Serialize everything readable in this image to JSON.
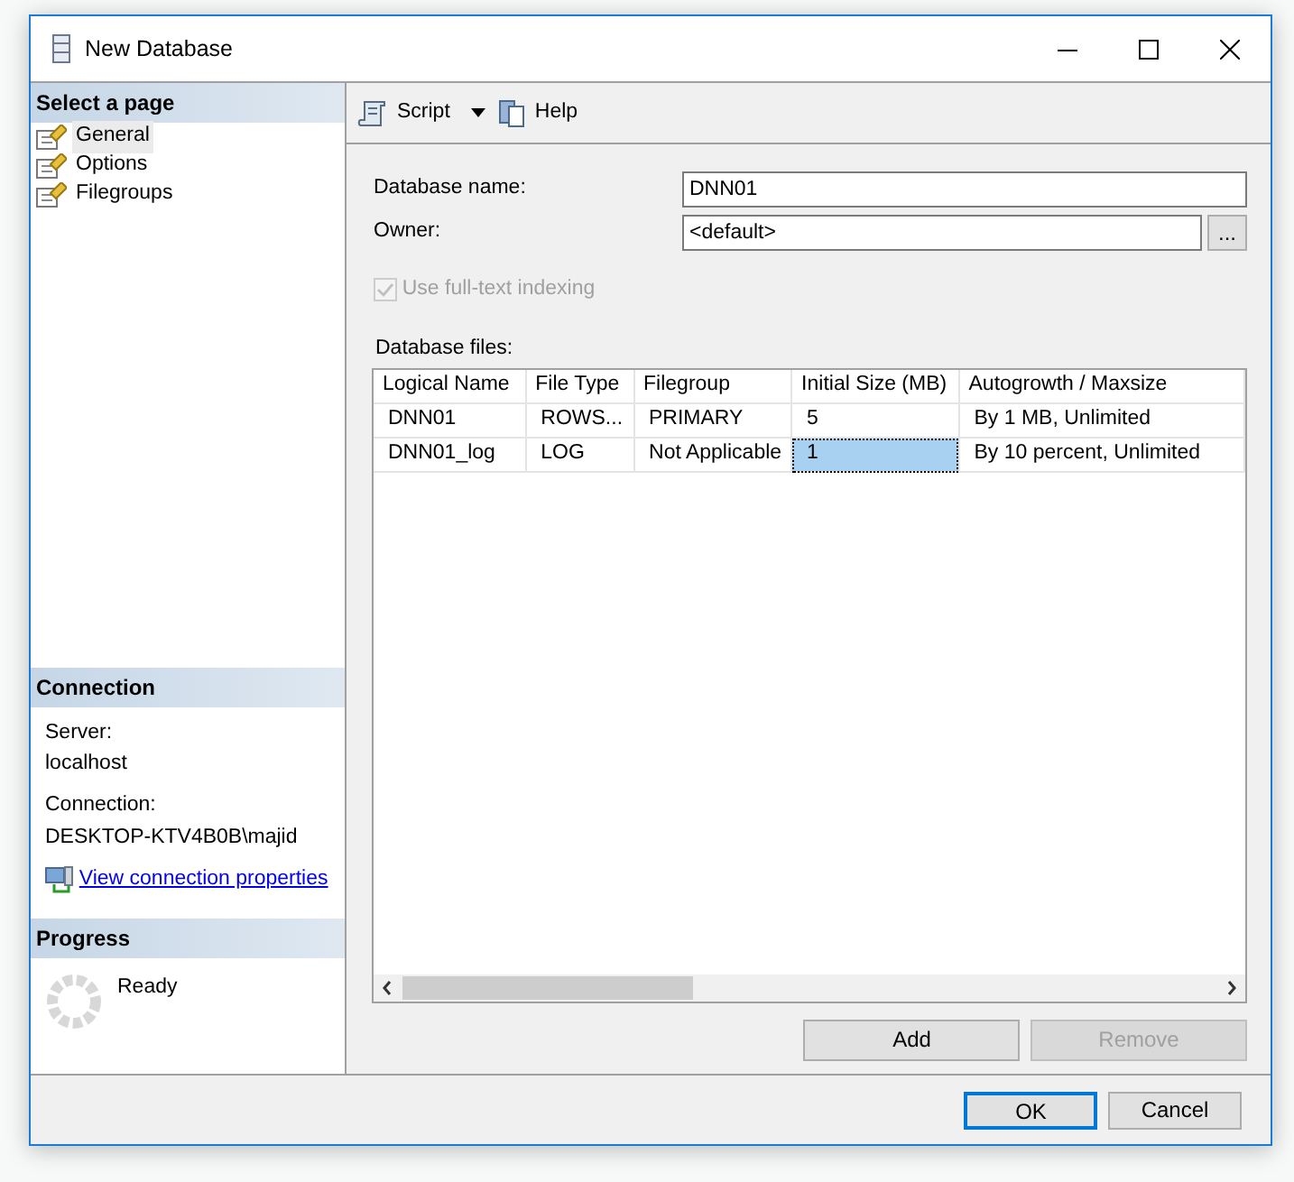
{
  "window": {
    "title": "New Database"
  },
  "sidebar": {
    "heading": "Select a page",
    "pages": [
      {
        "label": "General",
        "selected": true
      },
      {
        "label": "Options",
        "selected": false
      },
      {
        "label": "Filegroups",
        "selected": false
      }
    ]
  },
  "connection": {
    "heading": "Connection",
    "server_label": "Server:",
    "server": "localhost",
    "connection_label": "Connection:",
    "connection": "DESKTOP-KTV4B0B\\majid",
    "link": "View connection properties"
  },
  "progress": {
    "heading": "Progress",
    "status": "Ready"
  },
  "toolbar": {
    "script": "Script",
    "help": "Help"
  },
  "form": {
    "name_label": "Database name:",
    "name_value": "DNN01",
    "owner_label": "Owner:",
    "owner_value": "<default>",
    "browse": "...",
    "fulltext": {
      "label": "Use full-text indexing",
      "checked": true,
      "disabled": true
    }
  },
  "files": {
    "label": "Database files:",
    "columns": [
      "Logical Name",
      "File Type",
      "Filegroup",
      "Initial Size (MB)",
      "Autogrowth / Maxsize"
    ],
    "rows": [
      {
        "cells": [
          {
            "text": "DNN01",
            "selected": false
          },
          {
            "text": "ROWS...",
            "selected": false
          },
          {
            "text": "PRIMARY",
            "selected": false
          },
          {
            "text": "5",
            "selected": false
          },
          {
            "text": "By 1 MB, Unlimited",
            "selected": false
          }
        ]
      },
      {
        "cells": [
          {
            "text": "DNN01_log",
            "selected": false
          },
          {
            "text": "LOG",
            "selected": false
          },
          {
            "text": "Not Applicable",
            "selected": false
          },
          {
            "text": "1",
            "selected": true
          },
          {
            "text": "By 10 percent, Unlimited",
            "selected": false
          }
        ]
      }
    ]
  },
  "file_buttons": [
    {
      "label": "Add",
      "disabled": false
    },
    {
      "label": "Remove",
      "disabled": true
    }
  ],
  "dialog_buttons": [
    {
      "label": "OK",
      "default": true
    },
    {
      "label": "Cancel",
      "default": false
    }
  ]
}
